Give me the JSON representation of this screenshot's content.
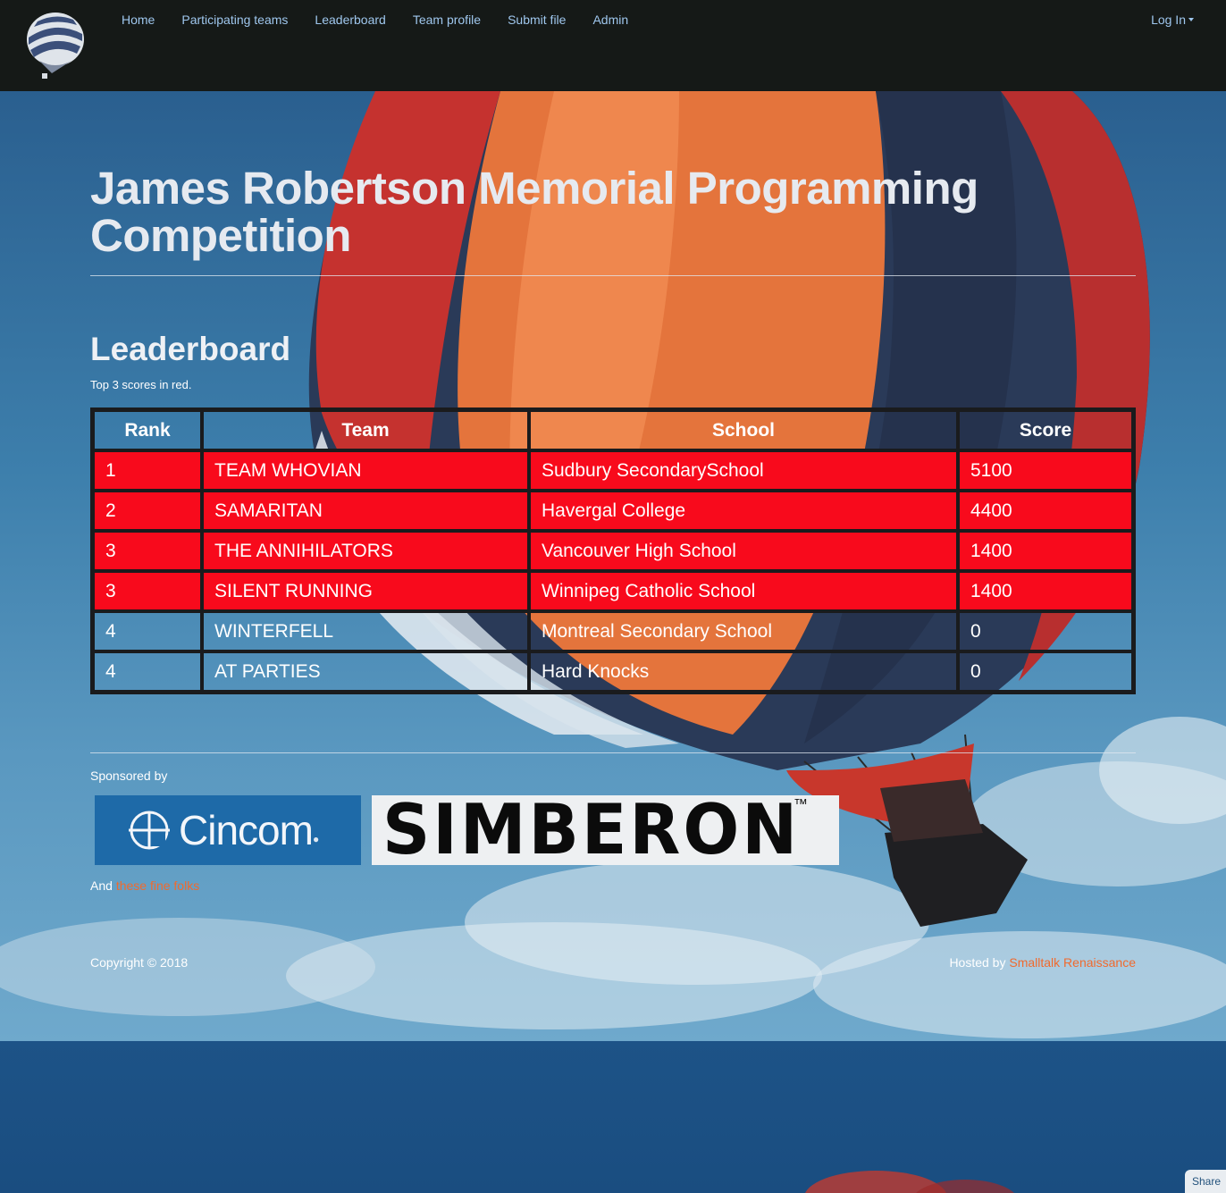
{
  "nav": {
    "links": [
      "Home",
      "Participating teams",
      "Leaderboard",
      "Team profile",
      "Submit file",
      "Admin"
    ],
    "login": "Log In"
  },
  "page_title": "James Robertson Memorial Programming Competition",
  "leaderboard": {
    "title": "Leaderboard",
    "note": "Top 3 scores in red.",
    "columns": [
      "Rank",
      "Team",
      "School",
      "Score"
    ],
    "rows": [
      {
        "rank": "1",
        "team": "TEAM WHOVIAN",
        "school": "Sudbury SecondarySchool",
        "score": "5100",
        "top": true
      },
      {
        "rank": "2",
        "team": "SAMARITAN",
        "school": "Havergal College",
        "score": "4400",
        "top": true
      },
      {
        "rank": "3",
        "team": "THE ANNIHILATORS",
        "school": "Vancouver High School",
        "score": "1400",
        "top": true
      },
      {
        "rank": "3",
        "team": "SILENT RUNNING",
        "school": "Winnipeg Catholic School",
        "score": "1400",
        "top": true
      },
      {
        "rank": "4",
        "team": "WINTERFELL",
        "school": "Montreal Secondary School",
        "score": "0",
        "top": false
      },
      {
        "rank": "4",
        "team": "AT PARTIES",
        "school": "Hard Knocks",
        "score": "0",
        "top": false
      }
    ],
    "top_color": "#f80a1c"
  },
  "sponsors": {
    "label": "Sponsored by",
    "logos": [
      "Cincom",
      "SIMBERON"
    ],
    "and_prefix": "And ",
    "and_link": "these fine folks"
  },
  "footer": {
    "copyright": "Copyright © 2018",
    "hosted_prefix": "Hosted by ",
    "hosted_link": "Smalltalk Renaissance"
  },
  "share": "Share",
  "colors": {
    "navbar": "#151917",
    "nav_link": "#9fc7ee",
    "accent_link": "#f06a2e"
  }
}
